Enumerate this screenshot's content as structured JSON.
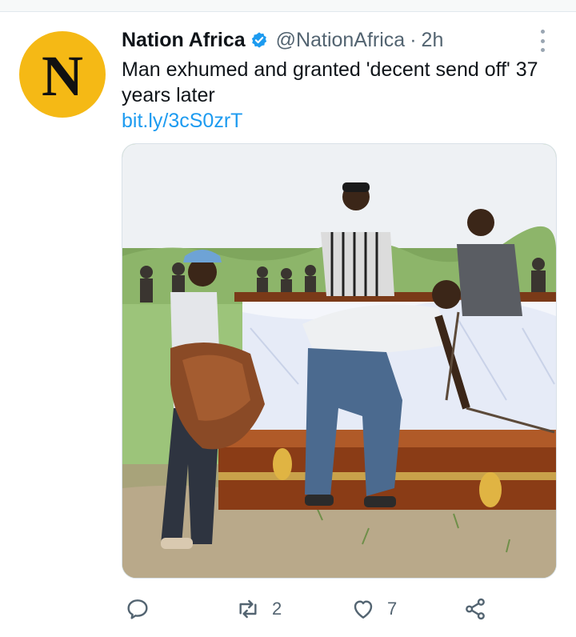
{
  "tweet": {
    "avatar_letter": "N",
    "display_name": "Nation Africa",
    "handle": "@NationAfrica",
    "separator": "·",
    "time": "2h",
    "text": "Man exhumed and granted 'decent send off' 37 years later",
    "link": "bit.ly/3cS0zrT",
    "verified": true
  },
  "actions": {
    "reply_icon": "reply-icon",
    "retweet_icon": "retweet-icon",
    "retweet_count": "2",
    "like_icon": "heart-icon",
    "like_count": "7",
    "share_icon": "share-icon"
  },
  "colors": {
    "avatar_bg": "#f5b915",
    "link": "#1d9bf0",
    "verified": "#1d9bf0",
    "muted": "#536471"
  }
}
